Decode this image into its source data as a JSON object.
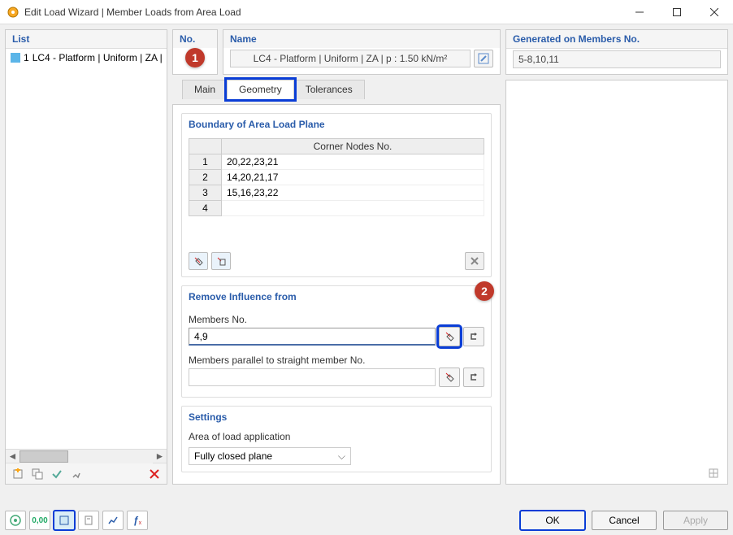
{
  "window": {
    "title": "Edit Load Wizard | Member Loads from Area Load"
  },
  "list": {
    "header": "List",
    "items": [
      {
        "num": "1",
        "label": "LC4 - Platform | Uniform | ZA | p :"
      }
    ]
  },
  "no_panel": {
    "header": "No."
  },
  "name_panel": {
    "header": "Name",
    "value": "LC4 - Platform | Uniform | ZA | p : 1.50 kN/m²"
  },
  "generated_panel": {
    "header": "Generated on Members No.",
    "value": "5-8,10,11"
  },
  "tabs": {
    "main": "Main",
    "geometry": "Geometry",
    "tolerances": "Tolerances"
  },
  "geometry": {
    "boundary": {
      "title": "Boundary of Area Load Plane",
      "col_header": "Corner Nodes No.",
      "rows": [
        {
          "num": "1",
          "nodes": "20,22,23,21"
        },
        {
          "num": "2",
          "nodes": "14,20,21,17"
        },
        {
          "num": "3",
          "nodes": "15,16,23,22"
        },
        {
          "num": "4",
          "nodes": ""
        }
      ]
    },
    "remove": {
      "title": "Remove Influence from",
      "members_label": "Members No.",
      "members_value": "4,9",
      "parallel_label": "Members parallel to straight member No.",
      "parallel_value": ""
    },
    "settings": {
      "title": "Settings",
      "area_label": "Area of load application",
      "area_value": "Fully closed plane"
    }
  },
  "buttons": {
    "ok": "OK",
    "cancel": "Cancel",
    "apply": "Apply"
  },
  "badges": {
    "b1": "1",
    "b2": "2"
  }
}
